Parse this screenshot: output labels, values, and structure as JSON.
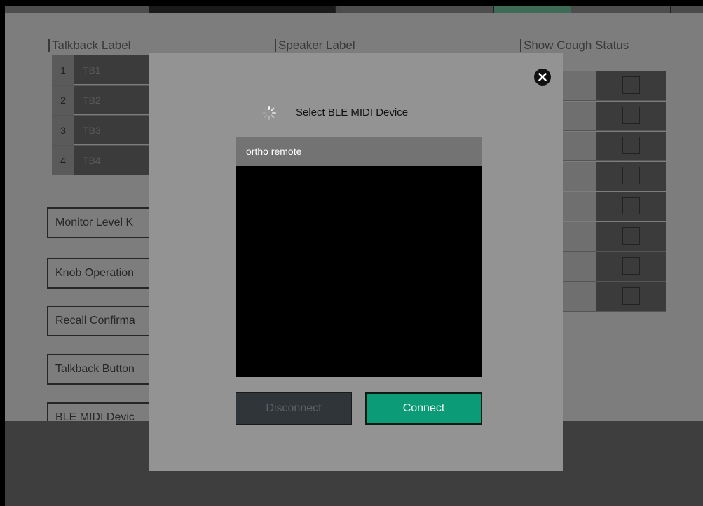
{
  "background": {
    "columns": {
      "talkback_label": "Talkback Label",
      "speaker_label": "Speaker Label",
      "show_cough_status": "Show Cough Status"
    },
    "talkback_rows": [
      {
        "number": "1",
        "label": "TB1"
      },
      {
        "number": "2",
        "label": "TB2"
      },
      {
        "number": "3",
        "label": "TB3"
      },
      {
        "number": "4",
        "label": "TB4"
      }
    ],
    "setting_buttons": [
      "Monitor Level K",
      "Knob Operation",
      "Recall Confirma",
      "Talkback Button",
      "BLE MIDI Devic"
    ],
    "cough_checkboxes": [
      false,
      false,
      false,
      false,
      false,
      false,
      false,
      false
    ]
  },
  "modal": {
    "title": "Select BLE MIDI Device",
    "loading_icon": "spinner-icon",
    "close_icon": "close-icon",
    "devices": [
      "ortho remote"
    ],
    "disconnect_label": "Disconnect",
    "connect_label": "Connect",
    "connect_color": "#0b9b77",
    "disconnect_enabled": false
  }
}
